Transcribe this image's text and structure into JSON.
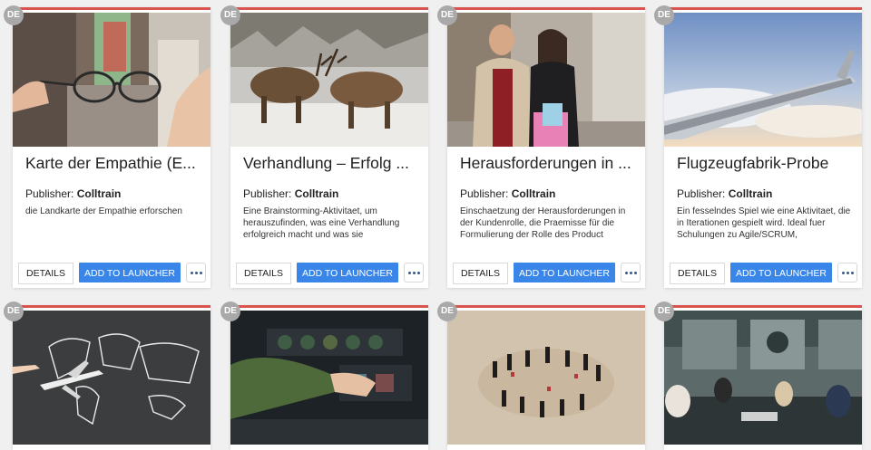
{
  "cards": [
    {
      "badge": "DE",
      "title": "Karte der Empathie (E...",
      "publisher_label": "Publisher:",
      "publisher_name": "Colltrain",
      "description": "die Landkarte der Empathie erforschen",
      "details_label": "DETAILS",
      "launch_label": "ADD TO LAUNCHER",
      "image": "glasses-in-hand-street-photo"
    },
    {
      "badge": "DE",
      "title": "Verhandlung – Erfolg ...",
      "publisher_label": "Publisher:",
      "publisher_name": "Colltrain",
      "description": "Eine Brainstorming-Aktivitaet, um herauszufinden, was eine Verhandlung erfolgreich macht und was sie",
      "details_label": "DETAILS",
      "launch_label": "ADD TO LAUNCHER",
      "image": "deer-fighting-in-snow-photo"
    },
    {
      "badge": "DE",
      "title": "Herausforderungen in ...",
      "publisher_label": "Publisher:",
      "publisher_name": "Colltrain",
      "description": "Einschaetzung der Herausforderungen in der Kundenrolle, die Praemisse für die Formulierung der Rolle des Product",
      "details_label": "DETAILS",
      "launch_label": "ADD TO LAUNCHER",
      "image": "shopping-couple-photo"
    },
    {
      "badge": "DE",
      "title": "Flugzeugfabrik-Probe",
      "publisher_label": "Publisher:",
      "publisher_name": "Colltrain",
      "description": "Ein fesselndes Spiel wie eine Aktivitaet, die in Iterationen gespielt wird. Ideal fuer Schulungen zu Agile/SCRUM,",
      "details_label": "DETAILS",
      "launch_label": "ADD TO LAUNCHER",
      "image": "airplane-wing-sky-photo"
    },
    {
      "badge": "DE",
      "image": "chalkboard-world-map-plane-photo"
    },
    {
      "badge": "DE",
      "image": "cockpit-controls-photo"
    },
    {
      "badge": "DE",
      "image": "people-circle-on-sand-photo"
    },
    {
      "badge": "DE",
      "image": "office-meeting-photo"
    }
  ],
  "colors": {
    "accent_line": "#d9534f",
    "launch_button": "#3a86e8",
    "badge": "#a9a9a9",
    "background": "#f0f0f0"
  }
}
